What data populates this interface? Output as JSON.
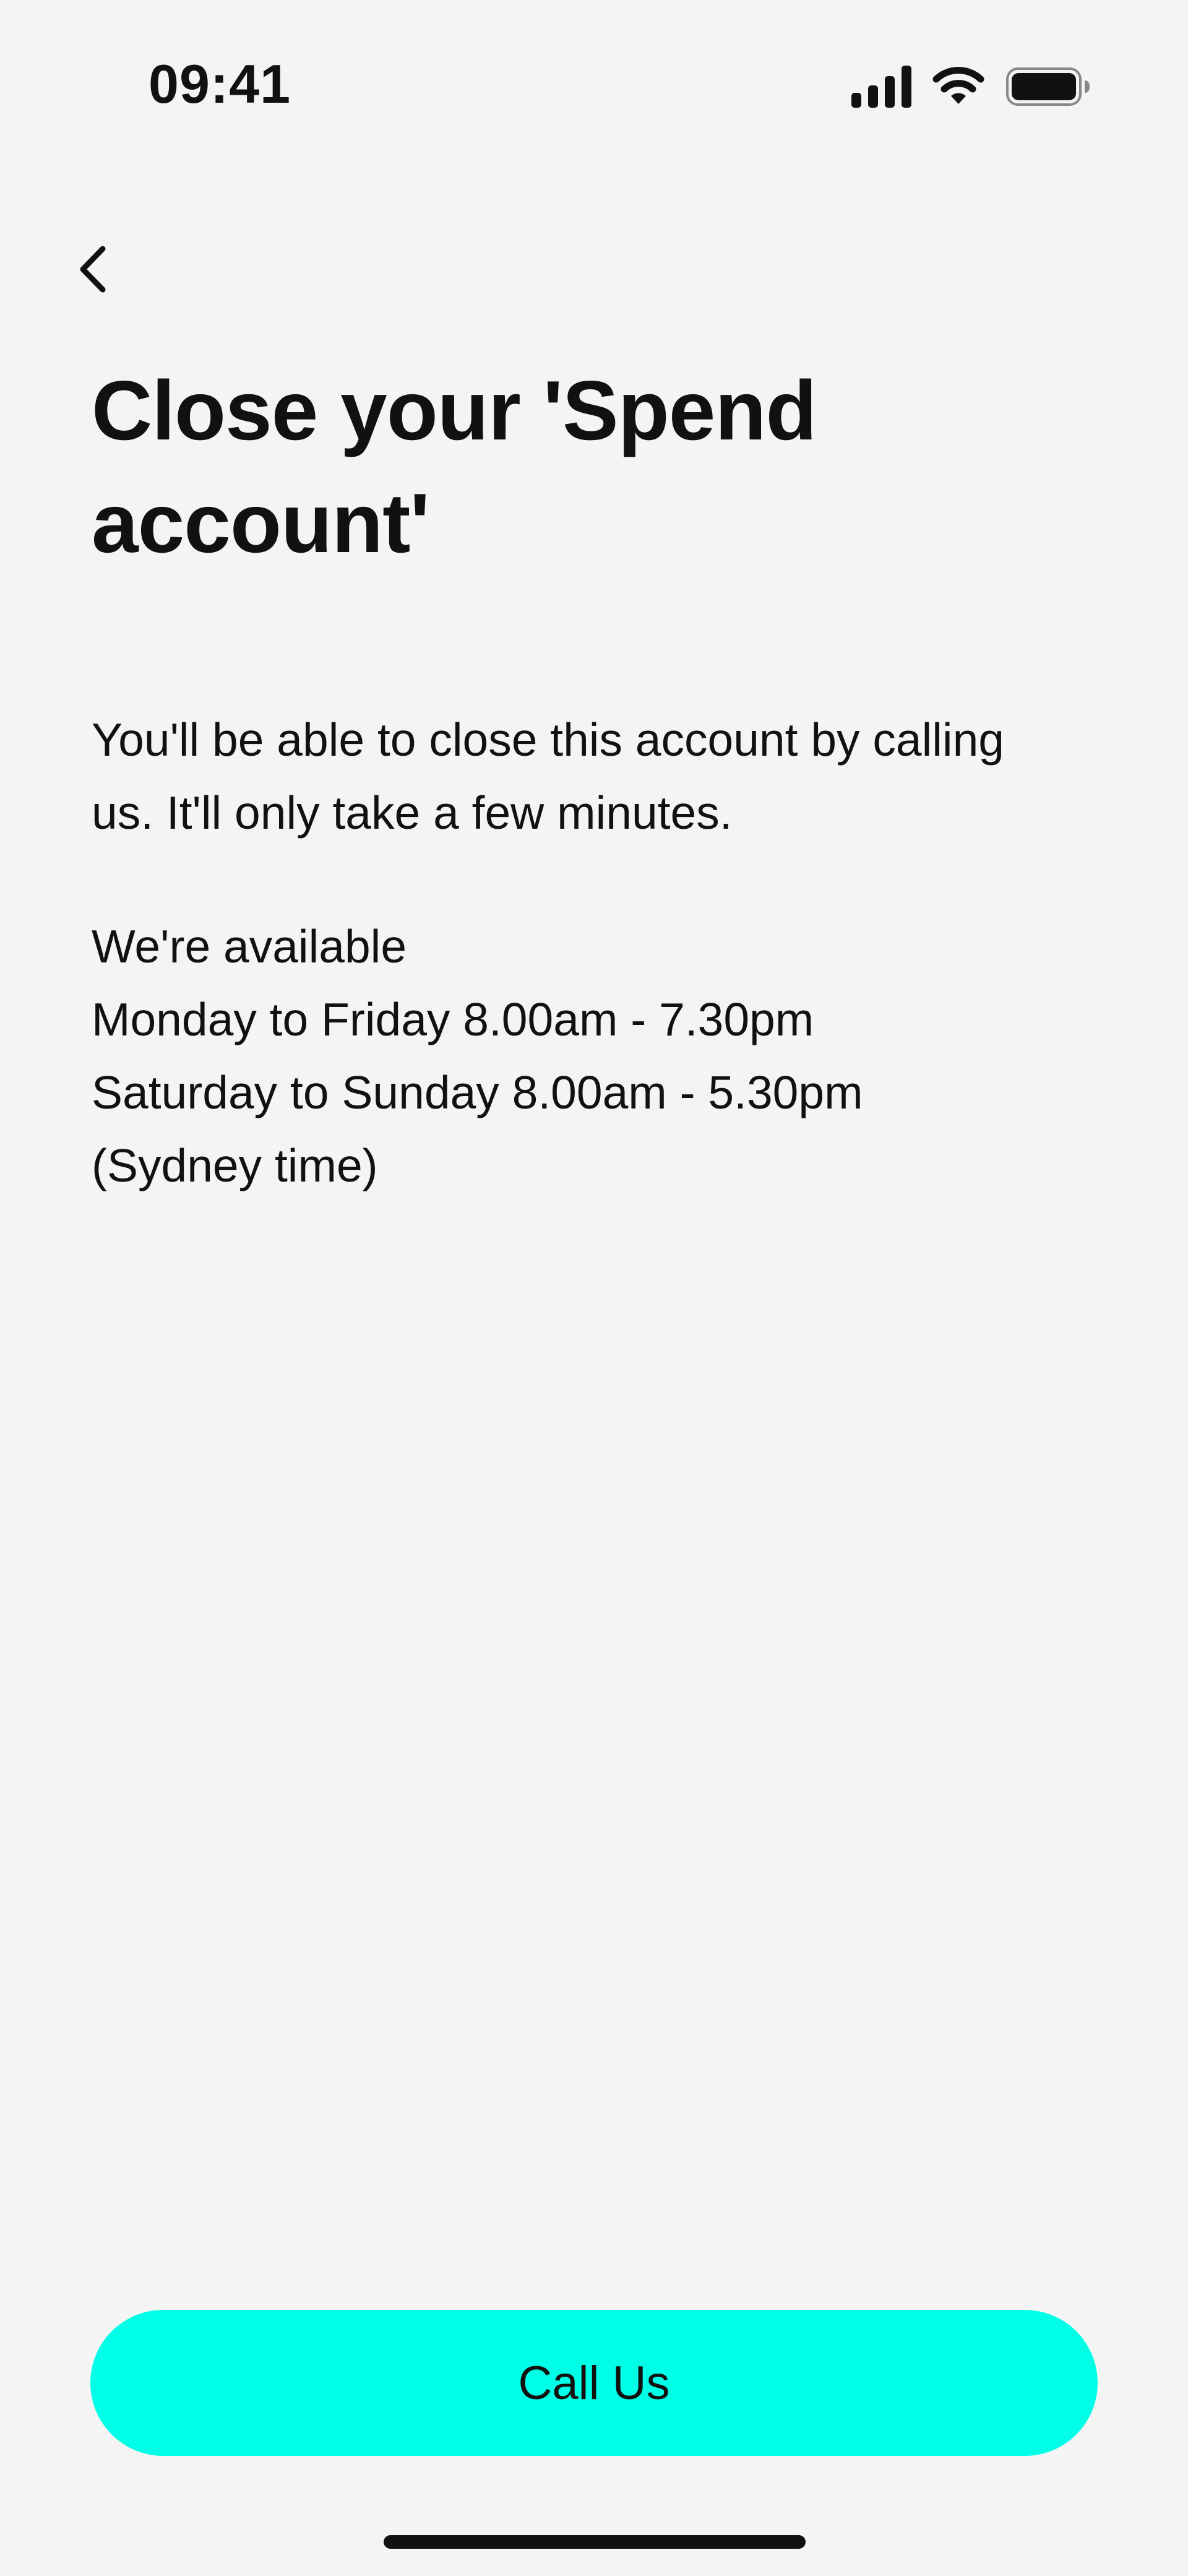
{
  "status_bar": {
    "time": "09:41",
    "icons": [
      "cellular-signal-icon",
      "wifi-icon",
      "battery-icon"
    ]
  },
  "nav": {
    "back_icon": "chevron-left-icon"
  },
  "page": {
    "title_line1": "Close your 'Spend",
    "title_line2": "account'",
    "body_line1": "You'll be able to close this account by calling",
    "body_line2": "us. It'll only take a few minutes.",
    "hours_heading": "We're available",
    "hours_weekdays": "Monday to Friday 8.00am - 7.30pm",
    "hours_weekend": "Saturday to Sunday 8.00am - 5.30pm",
    "hours_timezone": "(Sydney time)"
  },
  "actions": {
    "call_label": "Call Us"
  },
  "colors": {
    "background": "#f4f4f4",
    "accent": "#00ffe6",
    "text": "#111111"
  }
}
